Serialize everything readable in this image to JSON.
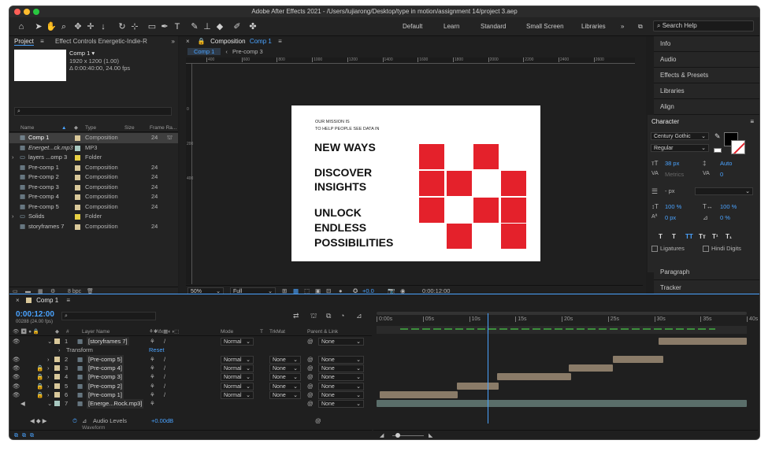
{
  "window": {
    "title": "Adobe After Effects 2021 - /Users/lujiarong/Desktop/type in motion/assignment 14/project 3.aep"
  },
  "workspaces": [
    "Default",
    "Learn",
    "Standard",
    "Small Screen",
    "Libraries"
  ],
  "search_help": "Search Help",
  "project_panel": {
    "tab_project": "Project",
    "tab_effect_controls": "Effect Controls Energetic-Indie-R",
    "selected_name": "Comp 1 ▾",
    "selected_info1": "1920 x 1200 (1.00)",
    "selected_info2": "Δ 0:00:40:00, 24.00 fps",
    "search_placeholder": "⌕",
    "columns": [
      "Name",
      "Type",
      "Size",
      "Frame Ra..."
    ],
    "items": [
      {
        "name": "Comp 1",
        "type": "Composition",
        "fps": "24",
        "color": "#d9c89a",
        "selected": true
      },
      {
        "name": "Energet...ck.mp3",
        "type": "MP3",
        "fps": "",
        "color": "#a8c8c0",
        "italic": true
      },
      {
        "name": "layers ...omp 3",
        "type": "Folder",
        "fps": "",
        "color": "#e8d044",
        "folder": true
      },
      {
        "name": "Pre-comp 1",
        "type": "Composition",
        "fps": "24",
        "color": "#d9c89a"
      },
      {
        "name": "Pre-comp 2",
        "type": "Composition",
        "fps": "24",
        "color": "#d9c89a"
      },
      {
        "name": "Pre-comp 3",
        "type": "Composition",
        "fps": "24",
        "color": "#d9c89a"
      },
      {
        "name": "Pre-comp 4",
        "type": "Composition",
        "fps": "24",
        "color": "#d9c89a"
      },
      {
        "name": "Pre-comp 5",
        "type": "Composition",
        "fps": "24",
        "color": "#d9c89a"
      },
      {
        "name": "Solids",
        "type": "Folder",
        "fps": "",
        "color": "#e8d044",
        "folder": true
      },
      {
        "name": "storyframes 7",
        "type": "Composition",
        "fps": "24",
        "color": "#d9c89a"
      }
    ],
    "bpc": "8 bpc"
  },
  "composition_panel": {
    "tab_label": "Composition",
    "tab_comp": "Comp 1",
    "breadcrumbs": [
      "Comp 1",
      "Pre-comp 3"
    ],
    "ruler": [
      "400",
      "600",
      "800",
      "1000",
      "1200",
      "1400",
      "1600",
      "1800",
      "2000",
      "2200",
      "2400",
      "2600"
    ],
    "ruler_left": [
      "0",
      "200",
      "400"
    ],
    "zoom": "50%",
    "resolution": "Full",
    "exposure": "+0.0",
    "timecode": "0:00:12:00"
  },
  "artwork": {
    "mission_line1": "OUR MISSION IS",
    "mission_line2": "TO HELP PEOPLE SEE DATA IN",
    "new_ways": "NEW WAYS",
    "discover": "DISCOVER",
    "insights": "INSIGHTS",
    "unlock": "UNLOCK",
    "endless": "ENDLESS",
    "possibilities": "POSSIBILITIES",
    "red": "#e4212b"
  },
  "right_panels": [
    "Info",
    "Audio",
    "Effects & Presets",
    "Libraries",
    "Align"
  ],
  "character": {
    "title": "Character",
    "font": "Century Gothic",
    "style": "Regular",
    "size": "38 px",
    "leading": "Auto",
    "kerning": "Metrics",
    "tracking": "0",
    "stroke": "- px",
    "vscale": "100 %",
    "hscale": "100 %",
    "baseline": "0 px",
    "tsume": "0 %",
    "styles": [
      "T",
      "T",
      "TT",
      "Tт",
      "T¹",
      "T₁"
    ],
    "ligatures": "Ligatures",
    "hindi": "Hindi Digits"
  },
  "bottom_right_panels": [
    "Paragraph",
    "Tracker"
  ],
  "timeline": {
    "tab": "Comp 1",
    "timecode": "0:00:12:00",
    "frames": "00288 (24.00 fps)",
    "columns": {
      "layer_name": "Layer Name",
      "mode": "Mode",
      "t": "T",
      "trkmat": "TrkMat",
      "parent": "Parent & Link"
    },
    "time_labels": [
      "0:00s",
      "05s",
      "10s",
      "15s",
      "20s",
      "25s",
      "30s",
      "35s",
      "40s"
    ],
    "layers": [
      {
        "num": "1",
        "name": "[storyframes 7]",
        "mode": "Normal",
        "trk": "",
        "parent": "None",
        "color": "#d9c89a",
        "bar": [
          30.5,
          40
        ]
      },
      {
        "num": "",
        "name": "Transform",
        "sub": true,
        "reset": "Reset"
      },
      {
        "num": "2",
        "name": "[Pre-comp 5]",
        "mode": "Normal",
        "trk": "None",
        "parent": "None",
        "color": "#d9c89a",
        "bar": [
          25.5,
          31
        ]
      },
      {
        "num": "3",
        "name": "[Pre-comp 4]",
        "mode": "Normal",
        "trk": "None",
        "parent": "None",
        "color": "#d9c89a",
        "bar": [
          20.8,
          25.5
        ]
      },
      {
        "num": "4",
        "name": "[Pre-comp 3]",
        "mode": "Normal",
        "trk": "None",
        "parent": "None",
        "color": "#d9c89a",
        "bar": [
          13,
          21
        ]
      },
      {
        "num": "5",
        "name": "[Pre-comp 2]",
        "mode": "Normal",
        "trk": "None",
        "parent": "None",
        "color": "#d9c89a",
        "bar": [
          8.7,
          13.2
        ]
      },
      {
        "num": "6",
        "name": "[Pre-comp 1]",
        "mode": "Normal",
        "trk": "None",
        "parent": "None",
        "color": "#d9c89a",
        "bar": [
          0.3,
          8.8
        ]
      },
      {
        "num": "7",
        "name": "[Energe...Rock.mp3]",
        "mode": "",
        "trk": "",
        "parent": "None",
        "color": "#a8c8c0",
        "bar": [
          0,
          40
        ],
        "audio": true
      }
    ],
    "audio_levels": "Audio Levels",
    "audio_value": "+0.00dB",
    "waveform": "Waveform",
    "playhead_seconds": 12,
    "duration_seconds": 40
  }
}
